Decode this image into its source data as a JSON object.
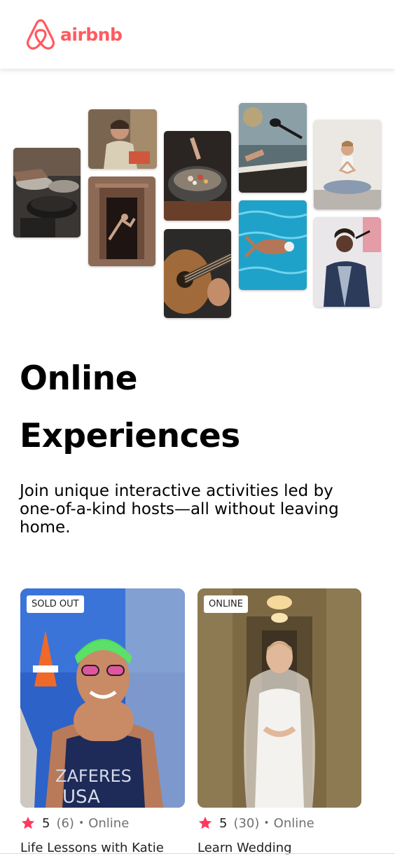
{
  "header": {
    "brand_name": "airbnb",
    "brand_color": "#FF5A5F",
    "logo_icon": "airbnb-belo-icon"
  },
  "collage": {
    "tiles": [
      "cooking-pots-photo",
      "woman-cooking-photo",
      "dancer-doorway-photo",
      "food-bowl-photo",
      "guitar-photo",
      "keyboard-microphone-photo",
      "swimmer-photo",
      "yoga-photo",
      "singer-photo"
    ]
  },
  "hero": {
    "title_line1": "Online",
    "title_line2": "Experiences",
    "subtitle": "Join unique interactive activities led by one-of-a-kind hosts—all without leaving home."
  },
  "experiences": [
    {
      "badge": "SOLD OUT",
      "rating": "5",
      "reviews": "(6)",
      "separator": "•",
      "mode": "Online",
      "title": "Life Lessons with Katie",
      "photo": "athlete-zaferes-photo"
    },
    {
      "badge": "ONLINE",
      "rating": "5",
      "reviews": "(30)",
      "separator": "•",
      "mode": "Online",
      "title": "Learn Wedding",
      "photo": "bride-photo"
    }
  ],
  "colors": {
    "star": "#FF385C",
    "muted_text": "#717171"
  }
}
